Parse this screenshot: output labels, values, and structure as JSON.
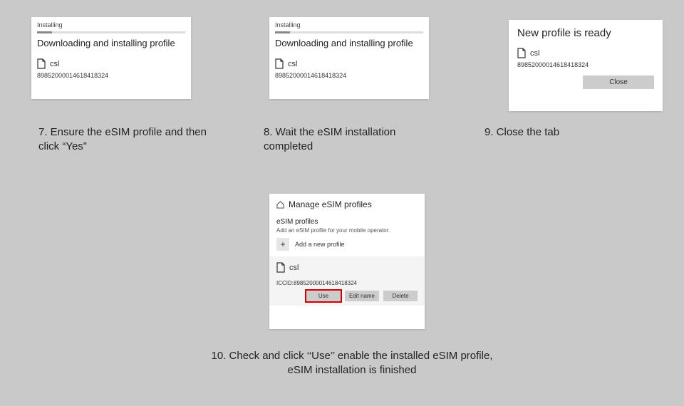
{
  "panel7": {
    "small_title": "Installing",
    "headline": "Downloading and installing profile",
    "carrier": "csl",
    "iccid": "89852000014618418324"
  },
  "panel8": {
    "small_title": "Installing",
    "headline": "Downloading and installing profile",
    "carrier": "csl",
    "iccid": "89852000014618418324"
  },
  "panel9": {
    "headline": "New profile is ready",
    "carrier": "csl",
    "iccid": "89852000014618418324",
    "close_label": "Close"
  },
  "panel10": {
    "title": "Manage eSIM profiles",
    "section": "eSIM profiles",
    "hint": "Add an eSIM profile for your mobile operator.",
    "add_label": "Add a new profile",
    "carrier": "csl",
    "iccid_line": "ICCID:89852000014618418324",
    "btn_use": "Use",
    "btn_edit": "Edit name",
    "btn_delete": "Delete"
  },
  "captions": {
    "c7": "7. Ensure the eSIM profile and then click “Yes”",
    "c8": "8. Wait the eSIM installation completed",
    "c9": "9. Close the tab",
    "c10": "10. Check and click ‘‘Use’’ enable the installed eSIM profile, eSIM installation is finished"
  }
}
